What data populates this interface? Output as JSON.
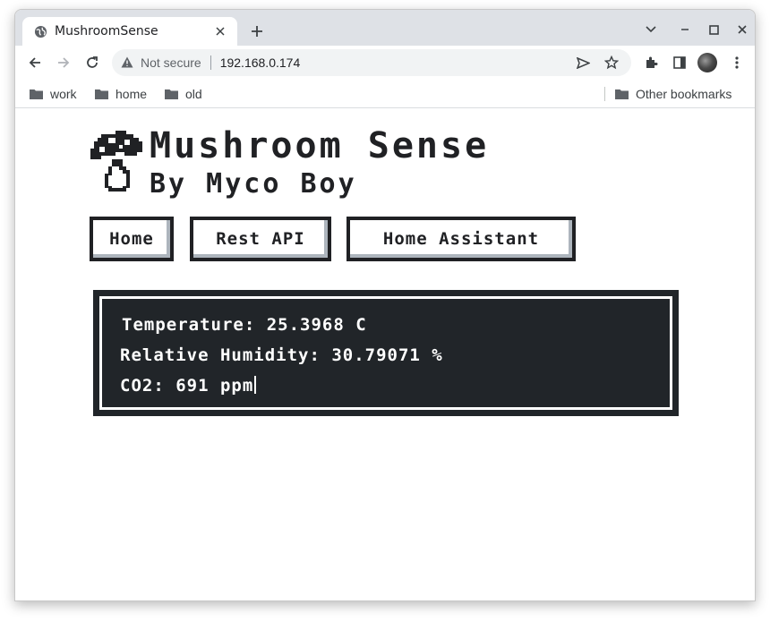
{
  "browser": {
    "tab": {
      "title": "MushroomSense",
      "favicon": "globe-icon"
    },
    "omnibox": {
      "security_label": "Not secure",
      "url": "192.168.0.174"
    },
    "bookmarks": [
      {
        "label": "work",
        "icon": "folder-icon"
      },
      {
        "label": "home",
        "icon": "folder-icon"
      },
      {
        "label": "old",
        "icon": "folder-icon"
      }
    ],
    "other_bookmarks": "Other bookmarks"
  },
  "site": {
    "title": "Mushroom Sense",
    "subtitle": "By Myco Boy",
    "logo": "mushroom-logo",
    "nav": [
      {
        "label": "Home"
      },
      {
        "label": "Rest API"
      },
      {
        "label": "Home Assistant"
      }
    ]
  },
  "readings": {
    "temperature": "Temperature: 25.3968 C",
    "humidity": "Relative Humidity: 30.79071 %",
    "co2": "CO2: 691 ppm"
  },
  "colors": {
    "tabstrip": "#dee1e6",
    "panel": "#212529",
    "text": "#202124",
    "button_shadow": "#adb5bd"
  }
}
